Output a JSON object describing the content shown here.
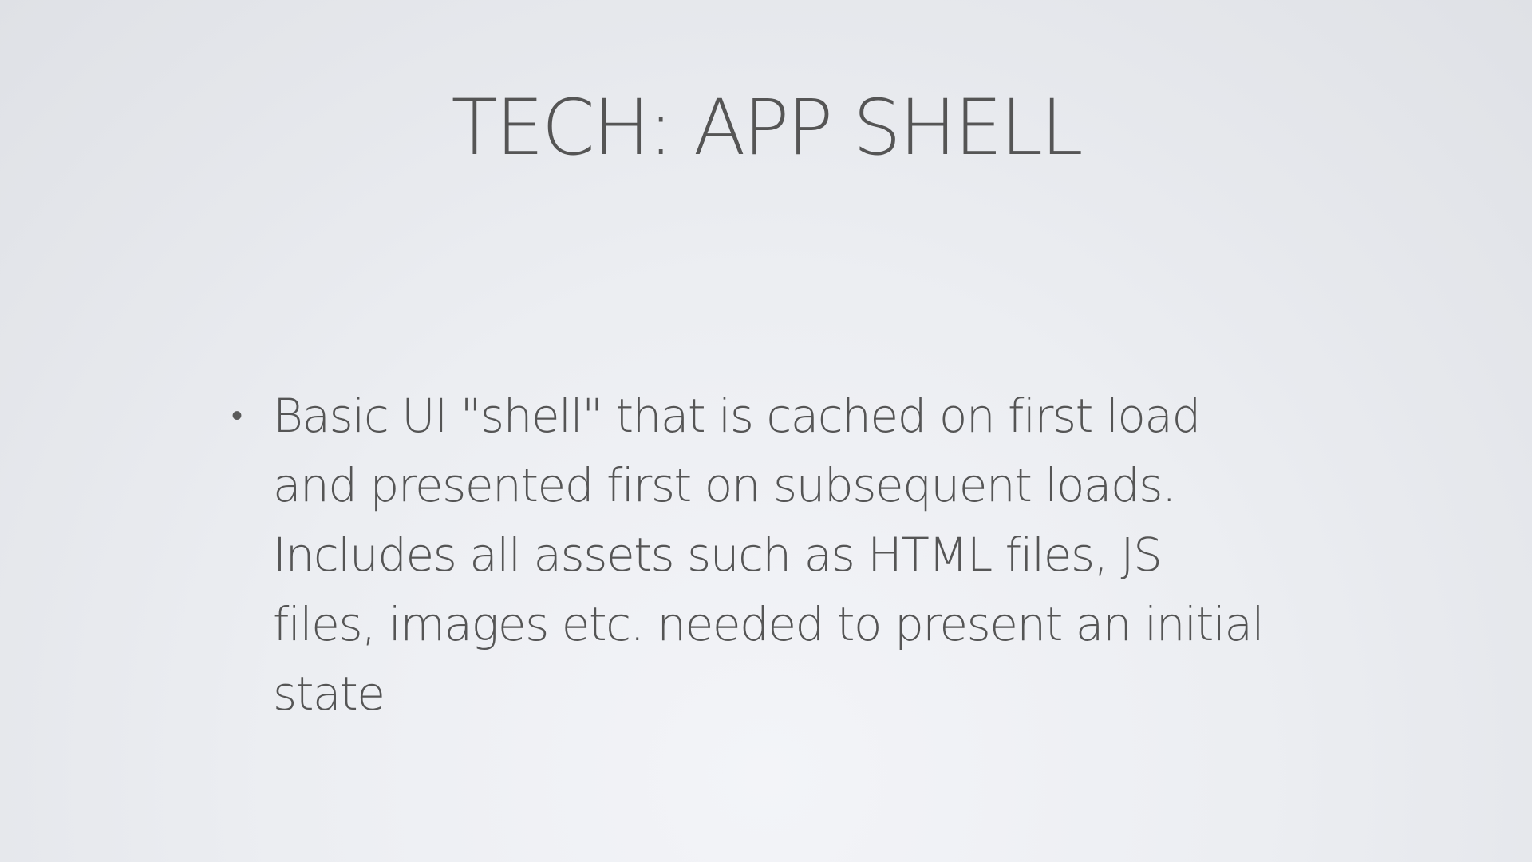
{
  "slide": {
    "title": "TECH: APP SHELL",
    "bullets": [
      {
        "marker": "•",
        "text": "Basic UI \"shell\" that is cached on first load and presented first on subsequent loads. Includes all assets such as HTML files, JS files, images etc. needed to present an initial state"
      }
    ]
  }
}
